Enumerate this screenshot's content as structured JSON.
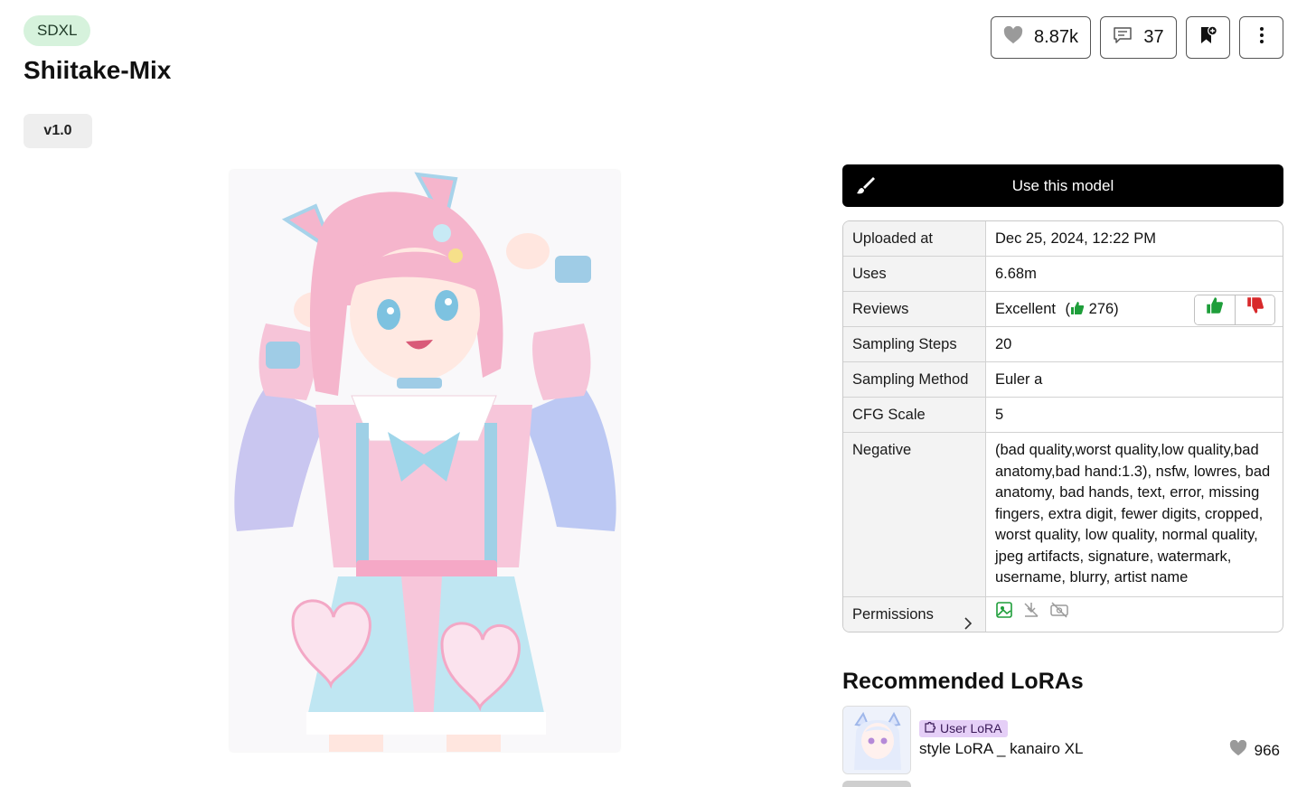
{
  "model": {
    "base_badge": "SDXL",
    "title": "Shiitake-Mix",
    "version": "v1.0"
  },
  "actions": {
    "likes": "8.87k",
    "comments": "37",
    "like_icon": "heart-icon",
    "comment_icon": "comment-icon",
    "bookmark_icon": "bookmark-add-icon",
    "more_icon": "more-vertical-icon"
  },
  "hero_image": {
    "icon": "anime-girl-cat-ears-illustration",
    "colors": {
      "hair": "#f5b5cc",
      "sleeve": "#b9c6f2",
      "skirt": "#bde4f2",
      "strap": "#9fd0e6"
    }
  },
  "use_button": {
    "label": "Use this model",
    "icon": "brush-icon"
  },
  "info": {
    "uploaded_label": "Uploaded at",
    "uploaded_value": "Dec 25, 2024, 12:22 PM",
    "uses_label": "Uses",
    "uses_value": "6.68m",
    "reviews_label": "Reviews",
    "reviews_value": "Excellent",
    "reviews_count": "276)",
    "reviews_open": "(",
    "steps_label": "Sampling Steps",
    "steps_value": "20",
    "method_label": "Sampling Method",
    "method_value": "Euler a",
    "cfg_label": "CFG Scale",
    "cfg_value": "5",
    "negative_label": "Negative",
    "negative_value": "(bad quality,worst quality,low quality,bad anatomy,bad hand:1.3), nsfw, lowres, bad anatomy, bad hands, text, error, missing fingers, extra digit, fewer digits, cropped, worst quality, low quality, normal quality, jpeg artifacts, signature, watermark, username, blurry, artist name",
    "permissions_label": "Permissions",
    "thumb_up_color": "#1e9e3a",
    "thumb_down_color": "#d8292b"
  },
  "recommended": {
    "title": "Recommended LoRAs",
    "items": [
      {
        "tag": "User LoRA",
        "name": "style LoRA _ kanairo XL",
        "likes": "966"
      }
    ]
  }
}
